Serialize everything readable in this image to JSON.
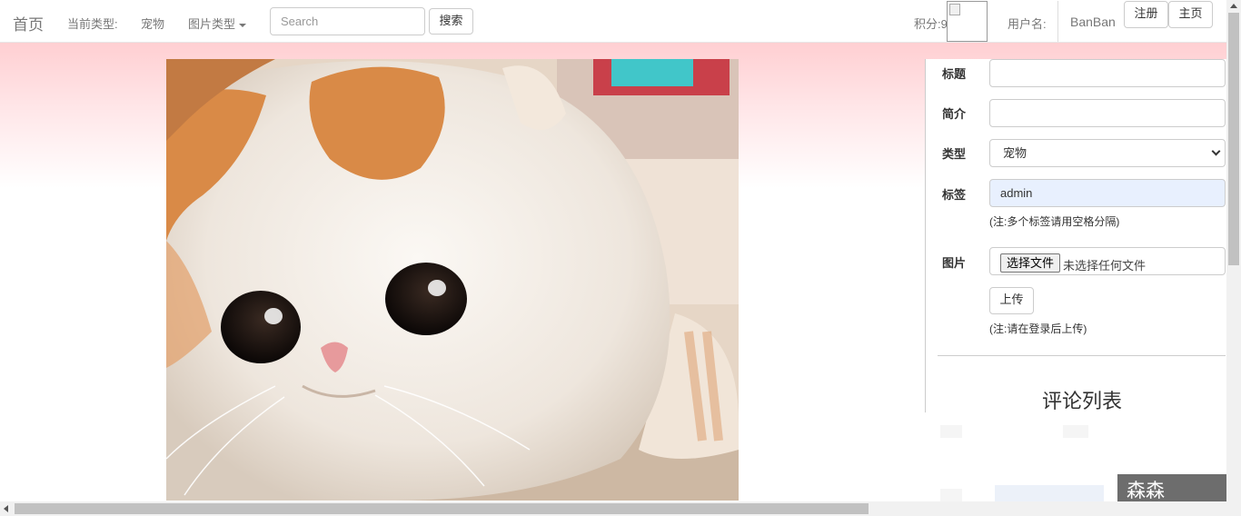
{
  "nav": {
    "brand": "首页",
    "current_type_label": "当前类型:",
    "current_type_value": "宠物",
    "image_type_dropdown": "图片类型",
    "search_placeholder": "Search",
    "search_button": "搜索",
    "points": "积分:9",
    "username_label": "用户名:",
    "username": "BanBan",
    "register_button": "注册",
    "home_button": "主页"
  },
  "form": {
    "title_label": "标题",
    "intro_label": "简介",
    "type_label": "类型",
    "type_selected": "宠物",
    "tags_label": "标签",
    "tags_value": "admin",
    "tags_hint": "(注:多个标签请用空格分隔)",
    "image_label": "图片",
    "file_choose": "选择文件",
    "file_status": "未选择任何文件",
    "upload_button": "上传",
    "upload_hint": "(注:请在登录后上传)"
  },
  "comments": {
    "title": "评论列表"
  },
  "watermark": "森森coding",
  "colors": {
    "hero_gradient_top": "#ffcfd2",
    "tags_autofill_bg": "#e8f0fe"
  }
}
